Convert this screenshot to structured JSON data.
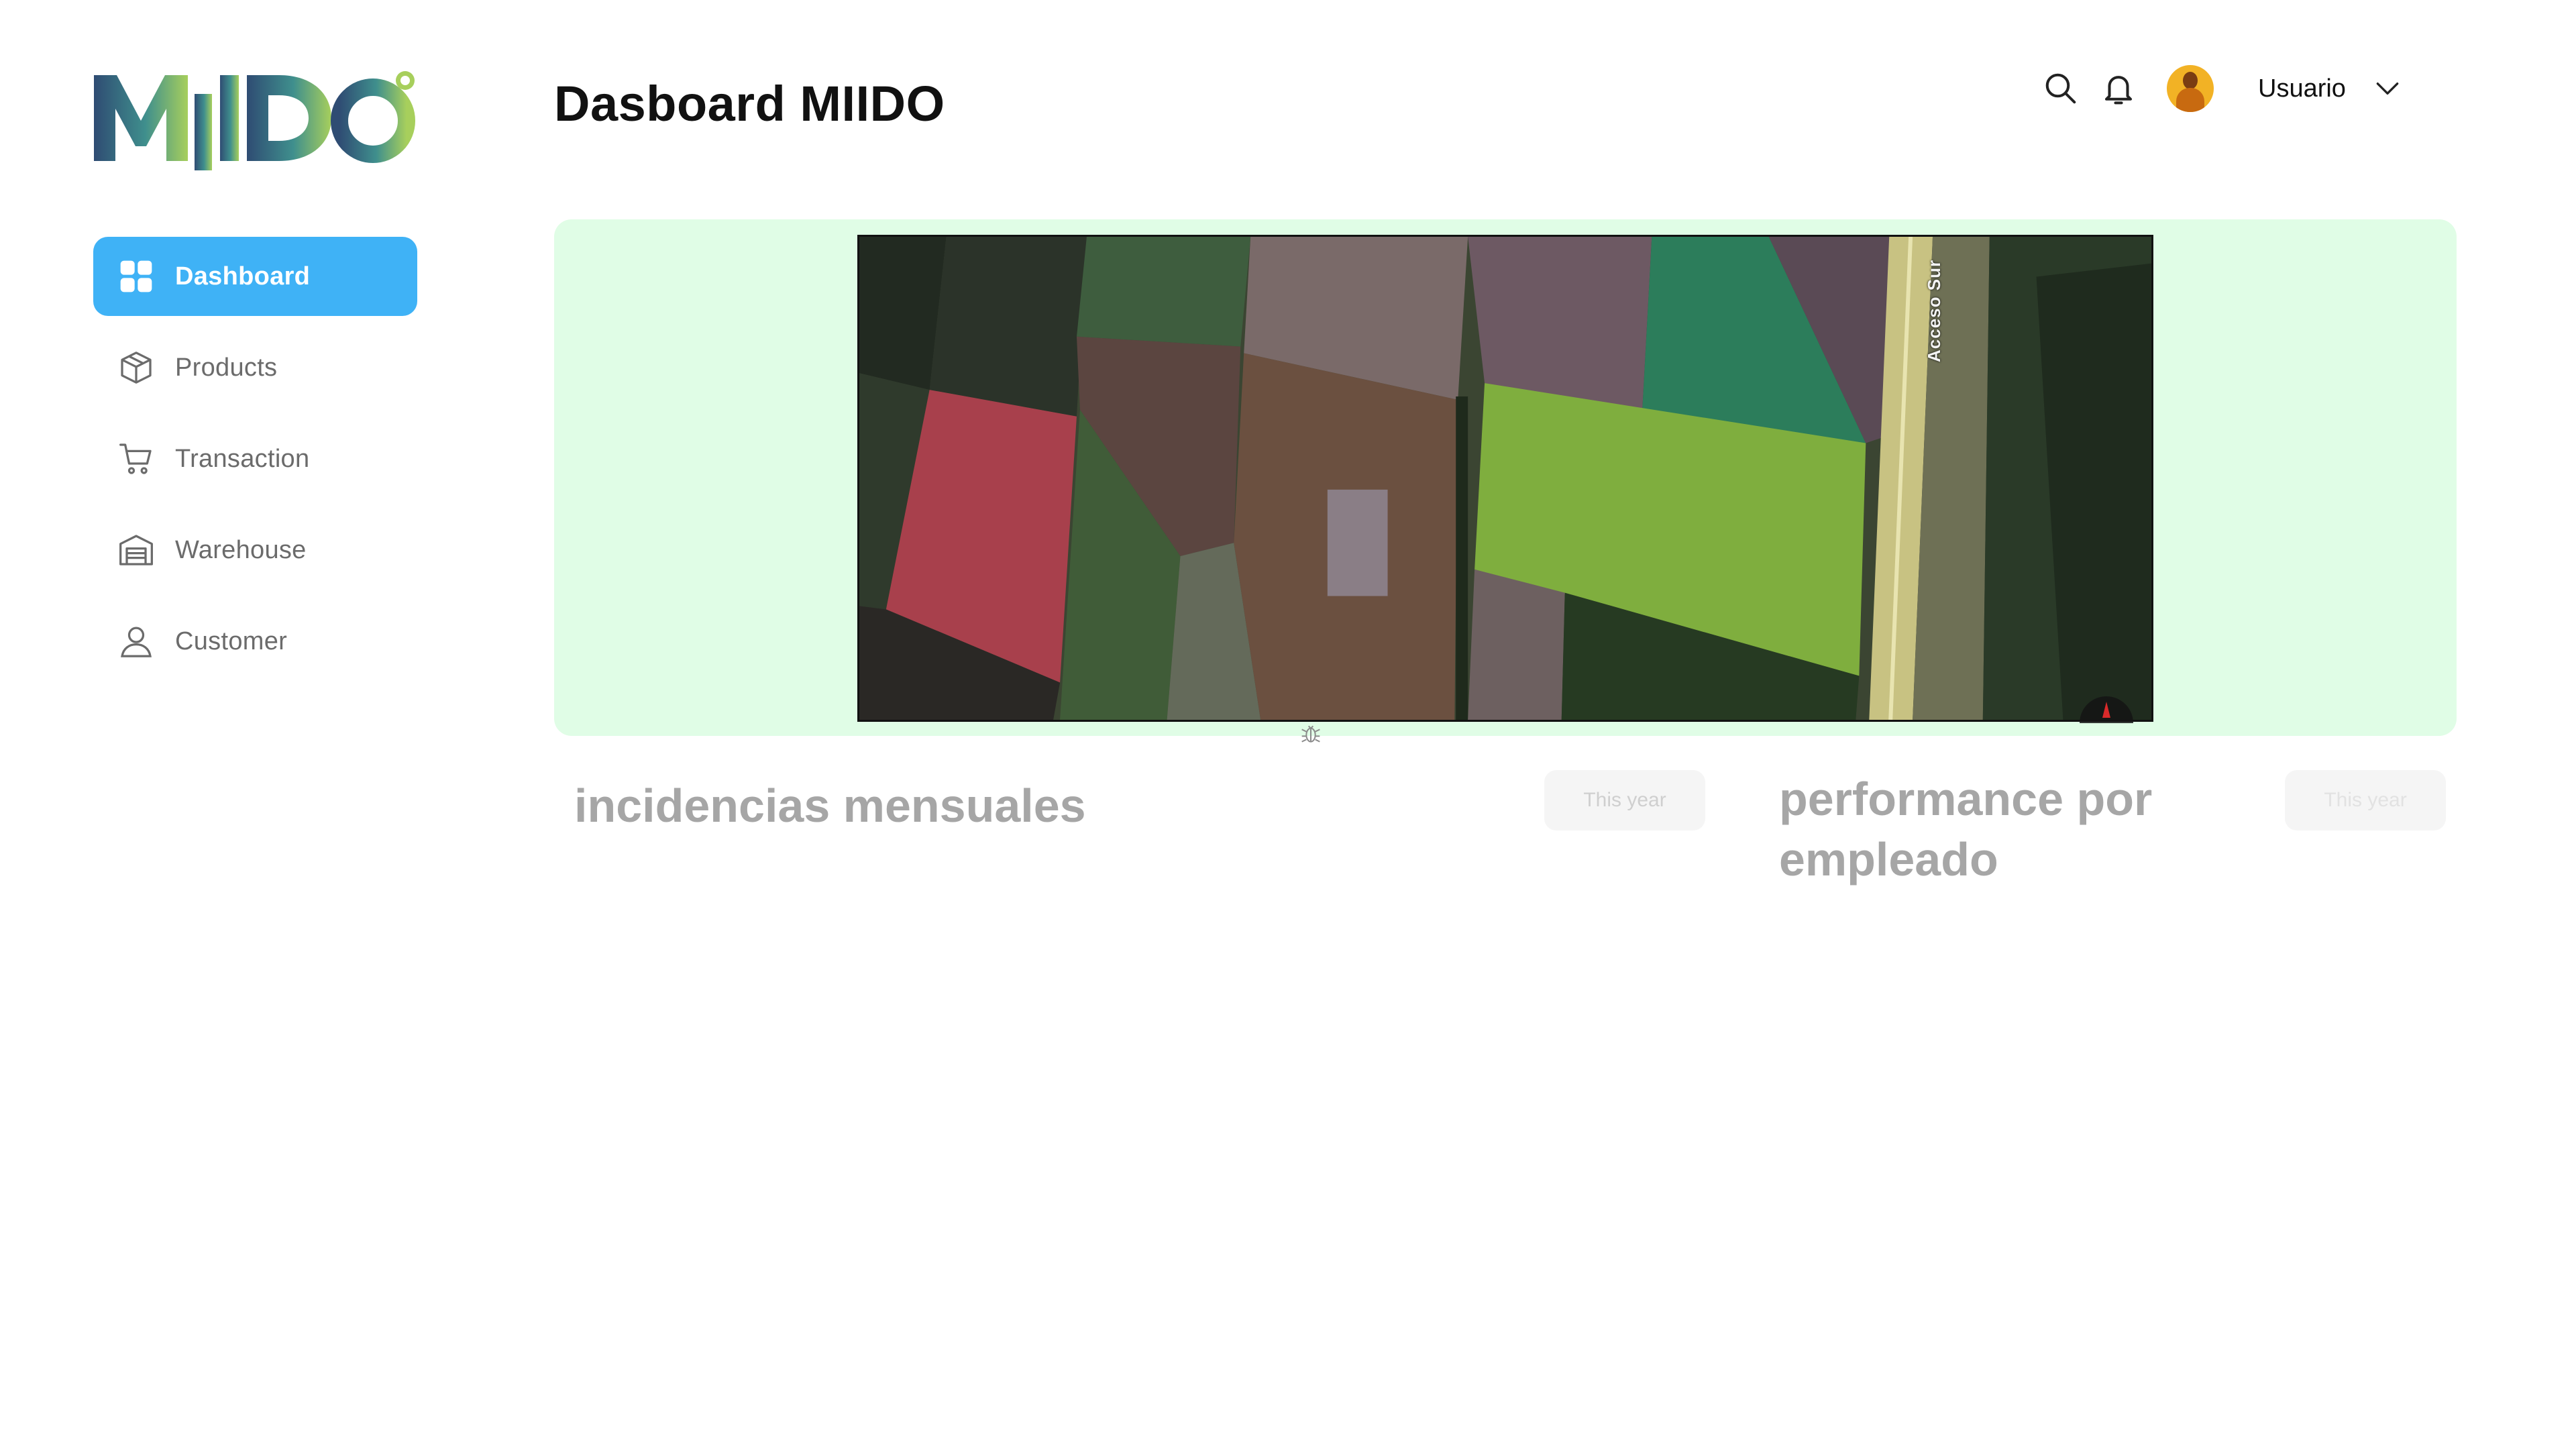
{
  "brand": {
    "logo_text": "MIIDO",
    "colors": [
      "#2f4c73",
      "#3f8f8d",
      "#9ccc5e"
    ]
  },
  "sidebar": {
    "items": [
      {
        "label": "Dashboard",
        "icon": "dashboard-grid-icon",
        "active": true
      },
      {
        "label": "Products",
        "icon": "box-icon",
        "active": false
      },
      {
        "label": "Transaction",
        "icon": "cart-icon",
        "active": false
      },
      {
        "label": "Warehouse",
        "icon": "warehouse-icon",
        "active": false
      },
      {
        "label": "Customer",
        "icon": "user-icon",
        "active": false
      }
    ],
    "active_color": "#3fb2f6"
  },
  "header": {
    "title": "Dasboard MIIDO",
    "icons": [
      "search-icon",
      "bell-icon"
    ],
    "user_name": "Usuario"
  },
  "banner": {
    "background": "#e0fde6",
    "map_label": "Acceso Sur"
  },
  "sections": [
    {
      "title": "incidencias mensuales",
      "filter_label": "This year"
    },
    {
      "title": "performance por empleado",
      "filter_label": "This year"
    }
  ]
}
